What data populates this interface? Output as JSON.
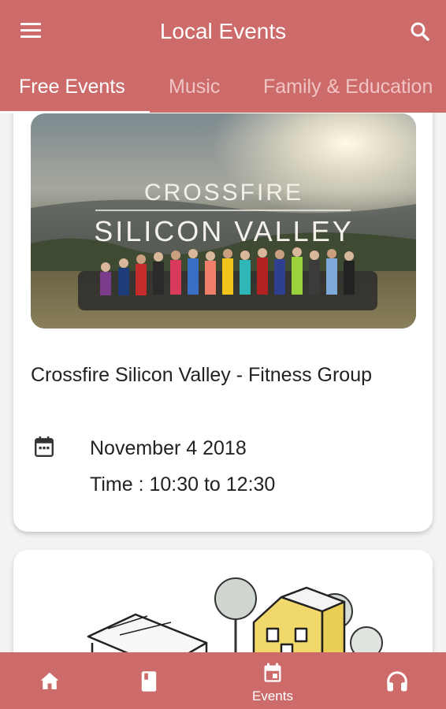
{
  "app": {
    "title": "Local Events"
  },
  "tabs": [
    {
      "label": "Free Events",
      "active": true
    },
    {
      "label": "Music",
      "active": false
    },
    {
      "label": "Family & Education",
      "active": false
    }
  ],
  "events": [
    {
      "image_text_line1": "CROSSFIRE",
      "image_text_line2": "SILICON VALLEY",
      "title": "Crossfire Silicon Valley - Fitness Group",
      "date": "November 4 2018",
      "time": "Time : 10:30 to 12:30"
    }
  ],
  "bottom_nav": [
    {
      "icon": "home-icon",
      "label": ""
    },
    {
      "icon": "book-icon",
      "label": ""
    },
    {
      "icon": "calendar-icon",
      "label": "Events",
      "active": true
    },
    {
      "icon": "headphones-icon",
      "label": ""
    }
  ],
  "colors": {
    "primary": "#cd6b6b",
    "tab_inactive": "#f0c4c4",
    "background": "#f3f3f3"
  }
}
